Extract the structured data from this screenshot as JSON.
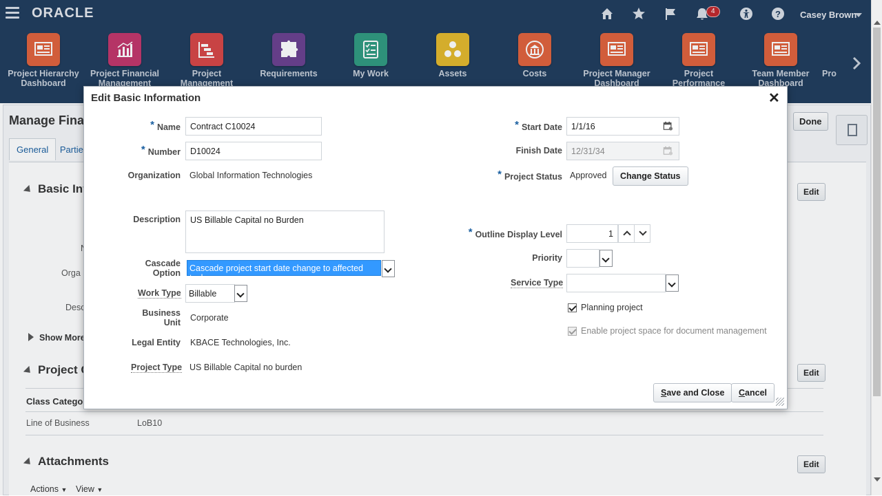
{
  "header": {
    "logo": "ORACLE",
    "notification_count": "4",
    "user_name": "Casey Brown",
    "icons": [
      "home-icon",
      "star-icon",
      "flag-icon",
      "bell-icon",
      "accessibility-icon",
      "help-icon"
    ]
  },
  "springboard": {
    "items": [
      {
        "label": "Project Hierarchy Dashboard",
        "color": "#e0613b"
      },
      {
        "label": "Project Financial Management",
        "color": "#c2356a"
      },
      {
        "label": "Project Management",
        "color": "#d64545"
      },
      {
        "label": "Requirements",
        "color": "#6a3f8f"
      },
      {
        "label": "My Work",
        "color": "#2f9a7f"
      },
      {
        "label": "Assets",
        "color": "#e3b82b"
      },
      {
        "label": "Costs",
        "color": "#e0613b"
      },
      {
        "label": "Project Manager Dashboard",
        "color": "#e0613b"
      },
      {
        "label": "Project Performance",
        "color": "#e0613b"
      },
      {
        "label": "Team Member Dashboard",
        "color": "#e0613b"
      },
      {
        "label": "Pro",
        "color": ""
      }
    ]
  },
  "background_page": {
    "title": "Manage Fina",
    "tabs": [
      "General",
      "Parties"
    ],
    "done_label": "Done",
    "sections": {
      "basic_info": "Basic Info",
      "project_classes": "Project C",
      "attachments": "Attachments"
    },
    "edit_label": "Edit",
    "show_more": "Show More",
    "side_labels": [
      "N",
      "Orga",
      "Desc"
    ],
    "class_category_header": "Class Catego",
    "class_row": {
      "category": "Line of Business",
      "code": "LoB10"
    },
    "actions_label": "Actions",
    "view_label": "View"
  },
  "dialog": {
    "title": "Edit Basic Information",
    "close_label": "✕",
    "left": {
      "name_label": "Name",
      "name_value": "Contract C10024",
      "number_label": "Number",
      "number_value": "D10024",
      "organization_label": "Organization",
      "organization_value": "Global Information Technologies",
      "description_label": "Description",
      "description_value": "US Billable Capital no Burden",
      "cascade_label_1": "Cascade",
      "cascade_label_2": "Option",
      "cascade_value": "Cascade project start date change to affected tasks",
      "work_type_label": "Work Type",
      "work_type_value": "Billable",
      "business_unit_label_1": "Business",
      "business_unit_label_2": "Unit",
      "business_unit_value": "Corporate",
      "legal_entity_label": "Legal Entity",
      "legal_entity_value": "KBACE Technologies, Inc.",
      "project_type_label": "Project Type",
      "project_type_value": "US Billable Capital no burden"
    },
    "right": {
      "start_date_label": "Start Date",
      "start_date_value": "1/1/16",
      "finish_date_label": "Finish Date",
      "finish_date_value": "12/31/34",
      "project_status_label": "Project Status",
      "project_status_value": "Approved",
      "change_status_label": "Change Status",
      "outline_level_label": "Outline Display Level",
      "outline_level_value": "1",
      "priority_label": "Priority",
      "priority_value": "",
      "service_type_label": "Service Type",
      "service_type_value": "",
      "planning_project_label": "Planning project",
      "planning_project_checked": true,
      "enable_space_label": "Enable project space for document management",
      "enable_space_checked": true
    },
    "save_close_first": "S",
    "save_close_rest": "ave and Close",
    "cancel_first": "C",
    "cancel_rest": "ancel"
  }
}
